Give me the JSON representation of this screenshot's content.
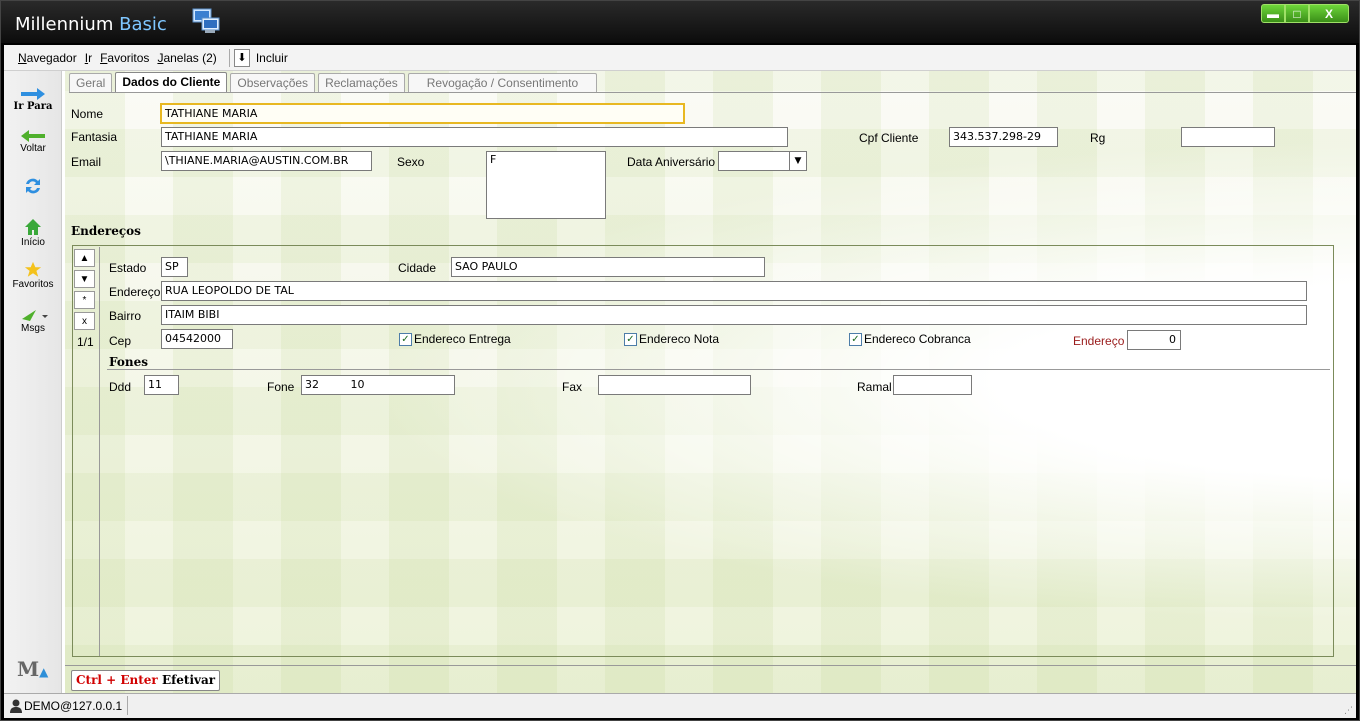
{
  "app": {
    "title_part1": "Millennium",
    "title_part2": "Basic"
  },
  "window_buttons": {
    "minimize": "▬",
    "maximize": "□",
    "close": "X"
  },
  "menu": {
    "items": [
      "Navegador",
      "Ir",
      "Favoritos",
      "Janelas (2)"
    ],
    "include_label": "Incluir"
  },
  "nav": {
    "ir_para": "Ir Para",
    "voltar": "Voltar",
    "inicio": "Início",
    "favoritos": "Favoritos",
    "msgs": "Msgs"
  },
  "tabs": [
    "Geral",
    "Dados do Cliente",
    "Observações",
    "Reclamações",
    "Revogação / Consentimento"
  ],
  "active_tab": "Dados do Cliente",
  "form": {
    "nome_label": "Nome",
    "nome_value": "TATHIANE MARIA",
    "fantasia_label": "Fantasia",
    "fantasia_value": "TATHIANE MARIA",
    "email_label": "Email",
    "email_value": "\\THIANE.MARIA@AUSTIN.COM.BR",
    "sexo_label": "Sexo",
    "sexo_value": "F",
    "data_aniv_label": "Data Aniversário",
    "data_aniv_value": "",
    "cpf_label": "Cpf Cliente",
    "cpf_value": "343.537.298-29",
    "rg_label": "Rg",
    "rg_value": ""
  },
  "enderecos": {
    "header": "Endereços",
    "record_pos": "1/1",
    "nav_buttons": [
      "▲",
      "▼",
      "*",
      "x"
    ],
    "estado_label": "Estado",
    "estado_value": "SP",
    "cidade_label": "Cidade",
    "cidade_value": "SAO PAULO",
    "endereco_label": "Endereço",
    "endereco_value": "RUA LEOPOLDO DE TAL",
    "bairro_label": "Bairro",
    "bairro_value": "ITAIM BIBI",
    "cep_label": "Cep",
    "cep_value": "04542000",
    "chk_entrega": "Endereco Entrega",
    "chk_nota": "Endereco Nota",
    "chk_cobranca": "Endereco Cobranca",
    "endereco_num_label": "Endereço",
    "endereco_num_value": "0"
  },
  "fones": {
    "header": "Fones",
    "ddd_label": "Ddd",
    "ddd_value": "11",
    "fone_label": "Fone",
    "fone_value": "32         10",
    "fax_label": "Fax",
    "fax_value": "",
    "ramal_label": "Ramal",
    "ramal_value": ""
  },
  "footer": {
    "ctrl_enter_key": "Ctrl + Enter",
    "ctrl_enter_action": "Efetivar"
  },
  "status": {
    "user": "DEMO@127.0.0.1"
  }
}
